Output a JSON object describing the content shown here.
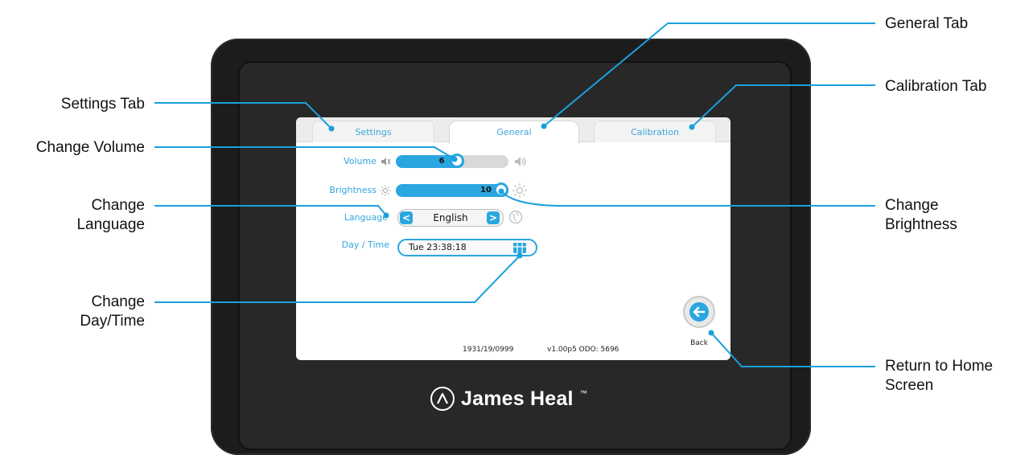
{
  "callouts": {
    "settings_tab": "Settings Tab",
    "change_volume": "Change Volume",
    "change_language": "Change\nLanguage",
    "change_day_time": "Change\nDay/Time",
    "general_tab": "General Tab",
    "calibration_tab": "Calibration Tab",
    "change_brightness": "Change\nBrightness",
    "return_home": "Return to Home\nScreen"
  },
  "screen": {
    "tabs": [
      {
        "label": "Settings",
        "active": false
      },
      {
        "label": "General",
        "active": true
      },
      {
        "label": "Calibration",
        "active": false
      }
    ],
    "volume": {
      "label": "Volume",
      "value": "6",
      "level": 0.55
    },
    "brightness": {
      "label": "Brightness",
      "value": "10",
      "level": 1.0
    },
    "language": {
      "label": "Language",
      "value": "English",
      "prev": "<",
      "next": ">"
    },
    "day_time": {
      "label": "Day / Time",
      "value": "Tue  23:38:18"
    },
    "footer": {
      "serial": "1931/19/0999",
      "version": "v1.00p5  ODO:  5696"
    },
    "back_label": "Back"
  },
  "brand": {
    "name": "James Heal",
    "trademark": "™"
  },
  "colors": {
    "accent": "#2aa6e0",
    "device": "#1c1c1c",
    "callout_line": "#1aa0dc"
  },
  "icons": [
    "mute-icon",
    "speaker-icon",
    "sun-low-icon",
    "sun-high-icon",
    "globe-icon",
    "calendar-icon",
    "back-arrow-icon",
    "brand-logo-icon"
  ]
}
